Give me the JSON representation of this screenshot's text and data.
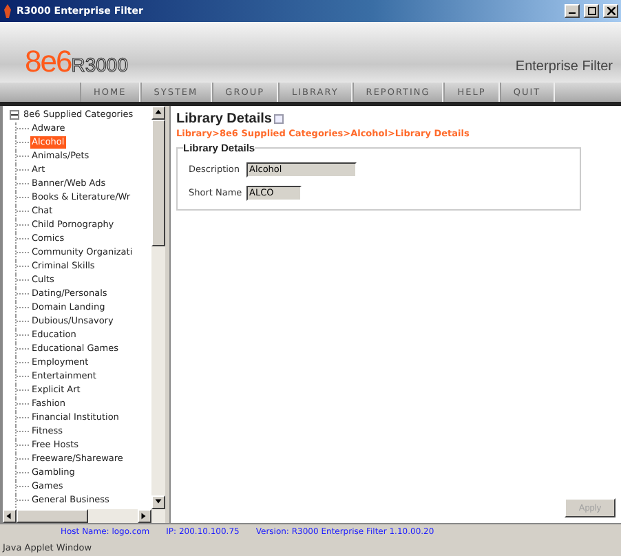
{
  "window": {
    "title": "R3000 Enterprise Filter"
  },
  "header": {
    "logo_number": "8e6",
    "logo_product": "R3000",
    "product_name": "Enterprise Filter"
  },
  "menu": [
    "HOME",
    "SYSTEM",
    "GROUP",
    "LIBRARY",
    "REPORTING",
    "HELP",
    "QUIT"
  ],
  "tree": {
    "label": "8e6 Supplied Categories",
    "expanded": true,
    "children": [
      {
        "label": "Adware",
        "selected": false
      },
      {
        "label": "Alcohol",
        "selected": true
      },
      {
        "label": "Animals/Pets",
        "selected": false
      },
      {
        "label": "Art",
        "selected": false
      },
      {
        "label": "Banner/Web Ads",
        "selected": false
      },
      {
        "label": "Books & Literature/Wr",
        "selected": false
      },
      {
        "label": "Chat",
        "selected": false
      },
      {
        "label": "Child Pornography",
        "selected": false
      },
      {
        "label": "Comics",
        "selected": false
      },
      {
        "label": "Community Organizati",
        "selected": false
      },
      {
        "label": "Criminal Skills",
        "selected": false
      },
      {
        "label": "Cults",
        "selected": false
      },
      {
        "label": "Dating/Personals",
        "selected": false
      },
      {
        "label": "Domain Landing",
        "selected": false
      },
      {
        "label": "Dubious/Unsavory",
        "selected": false
      },
      {
        "label": "Education",
        "selected": false
      },
      {
        "label": "Educational Games",
        "selected": false
      },
      {
        "label": "Employment",
        "selected": false
      },
      {
        "label": "Entertainment",
        "selected": false
      },
      {
        "label": "Explicit Art",
        "selected": false
      },
      {
        "label": "Fashion",
        "selected": false
      },
      {
        "label": "Financial Institution",
        "selected": false
      },
      {
        "label": "Fitness",
        "selected": false
      },
      {
        "label": "Free Hosts",
        "selected": false
      },
      {
        "label": "Freeware/Shareware",
        "selected": false
      },
      {
        "label": "Gambling",
        "selected": false
      },
      {
        "label": "Games",
        "selected": false
      },
      {
        "label": "General Business",
        "selected": false
      }
    ]
  },
  "details": {
    "title": "Library Details",
    "breadcrumb": "Library>8e6 Supplied Categories>Alcohol>Library Details",
    "group_title": "Library Details",
    "fields": [
      {
        "label": "Description",
        "value": "Alcohol"
      },
      {
        "label": "Short Name",
        "value": "ALCO"
      }
    ],
    "apply_button": {
      "label": "Apply",
      "disabled": true
    }
  },
  "status_bar": {
    "host": "Host Name: logo.com",
    "ip": "IP: 200.10.100.75",
    "version": "Version: R3000 Enterprise Filter 1.10.00.20"
  },
  "applet_label": "Java Applet Window"
}
